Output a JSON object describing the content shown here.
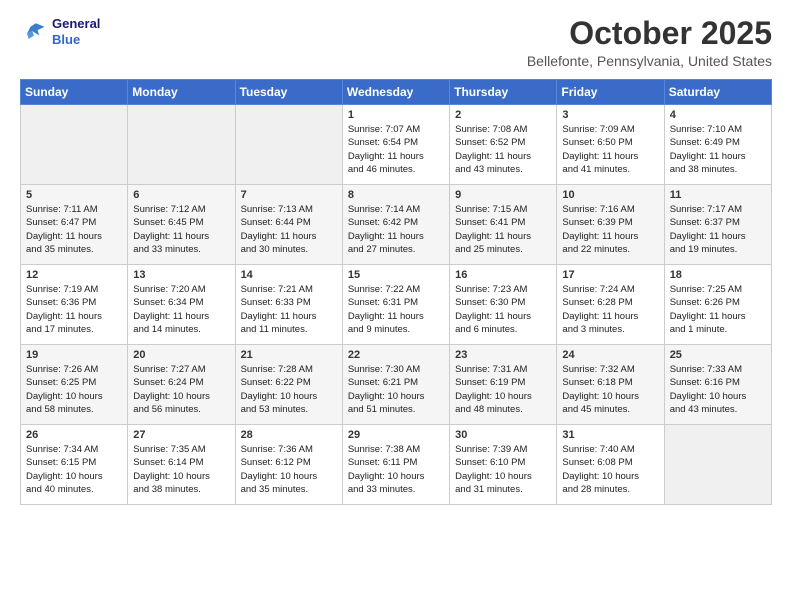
{
  "header": {
    "logo_line1": "General",
    "logo_line2": "Blue",
    "title": "October 2025",
    "subtitle": "Bellefonte, Pennsylvania, United States"
  },
  "days_of_week": [
    "Sunday",
    "Monday",
    "Tuesday",
    "Wednesday",
    "Thursday",
    "Friday",
    "Saturday"
  ],
  "weeks": [
    [
      {
        "day": "",
        "info": ""
      },
      {
        "day": "",
        "info": ""
      },
      {
        "day": "",
        "info": ""
      },
      {
        "day": "1",
        "info": "Sunrise: 7:07 AM\nSunset: 6:54 PM\nDaylight: 11 hours\nand 46 minutes."
      },
      {
        "day": "2",
        "info": "Sunrise: 7:08 AM\nSunset: 6:52 PM\nDaylight: 11 hours\nand 43 minutes."
      },
      {
        "day": "3",
        "info": "Sunrise: 7:09 AM\nSunset: 6:50 PM\nDaylight: 11 hours\nand 41 minutes."
      },
      {
        "day": "4",
        "info": "Sunrise: 7:10 AM\nSunset: 6:49 PM\nDaylight: 11 hours\nand 38 minutes."
      }
    ],
    [
      {
        "day": "5",
        "info": "Sunrise: 7:11 AM\nSunset: 6:47 PM\nDaylight: 11 hours\nand 35 minutes."
      },
      {
        "day": "6",
        "info": "Sunrise: 7:12 AM\nSunset: 6:45 PM\nDaylight: 11 hours\nand 33 minutes."
      },
      {
        "day": "7",
        "info": "Sunrise: 7:13 AM\nSunset: 6:44 PM\nDaylight: 11 hours\nand 30 minutes."
      },
      {
        "day": "8",
        "info": "Sunrise: 7:14 AM\nSunset: 6:42 PM\nDaylight: 11 hours\nand 27 minutes."
      },
      {
        "day": "9",
        "info": "Sunrise: 7:15 AM\nSunset: 6:41 PM\nDaylight: 11 hours\nand 25 minutes."
      },
      {
        "day": "10",
        "info": "Sunrise: 7:16 AM\nSunset: 6:39 PM\nDaylight: 11 hours\nand 22 minutes."
      },
      {
        "day": "11",
        "info": "Sunrise: 7:17 AM\nSunset: 6:37 PM\nDaylight: 11 hours\nand 19 minutes."
      }
    ],
    [
      {
        "day": "12",
        "info": "Sunrise: 7:19 AM\nSunset: 6:36 PM\nDaylight: 11 hours\nand 17 minutes."
      },
      {
        "day": "13",
        "info": "Sunrise: 7:20 AM\nSunset: 6:34 PM\nDaylight: 11 hours\nand 14 minutes."
      },
      {
        "day": "14",
        "info": "Sunrise: 7:21 AM\nSunset: 6:33 PM\nDaylight: 11 hours\nand 11 minutes."
      },
      {
        "day": "15",
        "info": "Sunrise: 7:22 AM\nSunset: 6:31 PM\nDaylight: 11 hours\nand 9 minutes."
      },
      {
        "day": "16",
        "info": "Sunrise: 7:23 AM\nSunset: 6:30 PM\nDaylight: 11 hours\nand 6 minutes."
      },
      {
        "day": "17",
        "info": "Sunrise: 7:24 AM\nSunset: 6:28 PM\nDaylight: 11 hours\nand 3 minutes."
      },
      {
        "day": "18",
        "info": "Sunrise: 7:25 AM\nSunset: 6:26 PM\nDaylight: 11 hours\nand 1 minute."
      }
    ],
    [
      {
        "day": "19",
        "info": "Sunrise: 7:26 AM\nSunset: 6:25 PM\nDaylight: 10 hours\nand 58 minutes."
      },
      {
        "day": "20",
        "info": "Sunrise: 7:27 AM\nSunset: 6:24 PM\nDaylight: 10 hours\nand 56 minutes."
      },
      {
        "day": "21",
        "info": "Sunrise: 7:28 AM\nSunset: 6:22 PM\nDaylight: 10 hours\nand 53 minutes."
      },
      {
        "day": "22",
        "info": "Sunrise: 7:30 AM\nSunset: 6:21 PM\nDaylight: 10 hours\nand 51 minutes."
      },
      {
        "day": "23",
        "info": "Sunrise: 7:31 AM\nSunset: 6:19 PM\nDaylight: 10 hours\nand 48 minutes."
      },
      {
        "day": "24",
        "info": "Sunrise: 7:32 AM\nSunset: 6:18 PM\nDaylight: 10 hours\nand 45 minutes."
      },
      {
        "day": "25",
        "info": "Sunrise: 7:33 AM\nSunset: 6:16 PM\nDaylight: 10 hours\nand 43 minutes."
      }
    ],
    [
      {
        "day": "26",
        "info": "Sunrise: 7:34 AM\nSunset: 6:15 PM\nDaylight: 10 hours\nand 40 minutes."
      },
      {
        "day": "27",
        "info": "Sunrise: 7:35 AM\nSunset: 6:14 PM\nDaylight: 10 hours\nand 38 minutes."
      },
      {
        "day": "28",
        "info": "Sunrise: 7:36 AM\nSunset: 6:12 PM\nDaylight: 10 hours\nand 35 minutes."
      },
      {
        "day": "29",
        "info": "Sunrise: 7:38 AM\nSunset: 6:11 PM\nDaylight: 10 hours\nand 33 minutes."
      },
      {
        "day": "30",
        "info": "Sunrise: 7:39 AM\nSunset: 6:10 PM\nDaylight: 10 hours\nand 31 minutes."
      },
      {
        "day": "31",
        "info": "Sunrise: 7:40 AM\nSunset: 6:08 PM\nDaylight: 10 hours\nand 28 minutes."
      },
      {
        "day": "",
        "info": ""
      }
    ]
  ]
}
